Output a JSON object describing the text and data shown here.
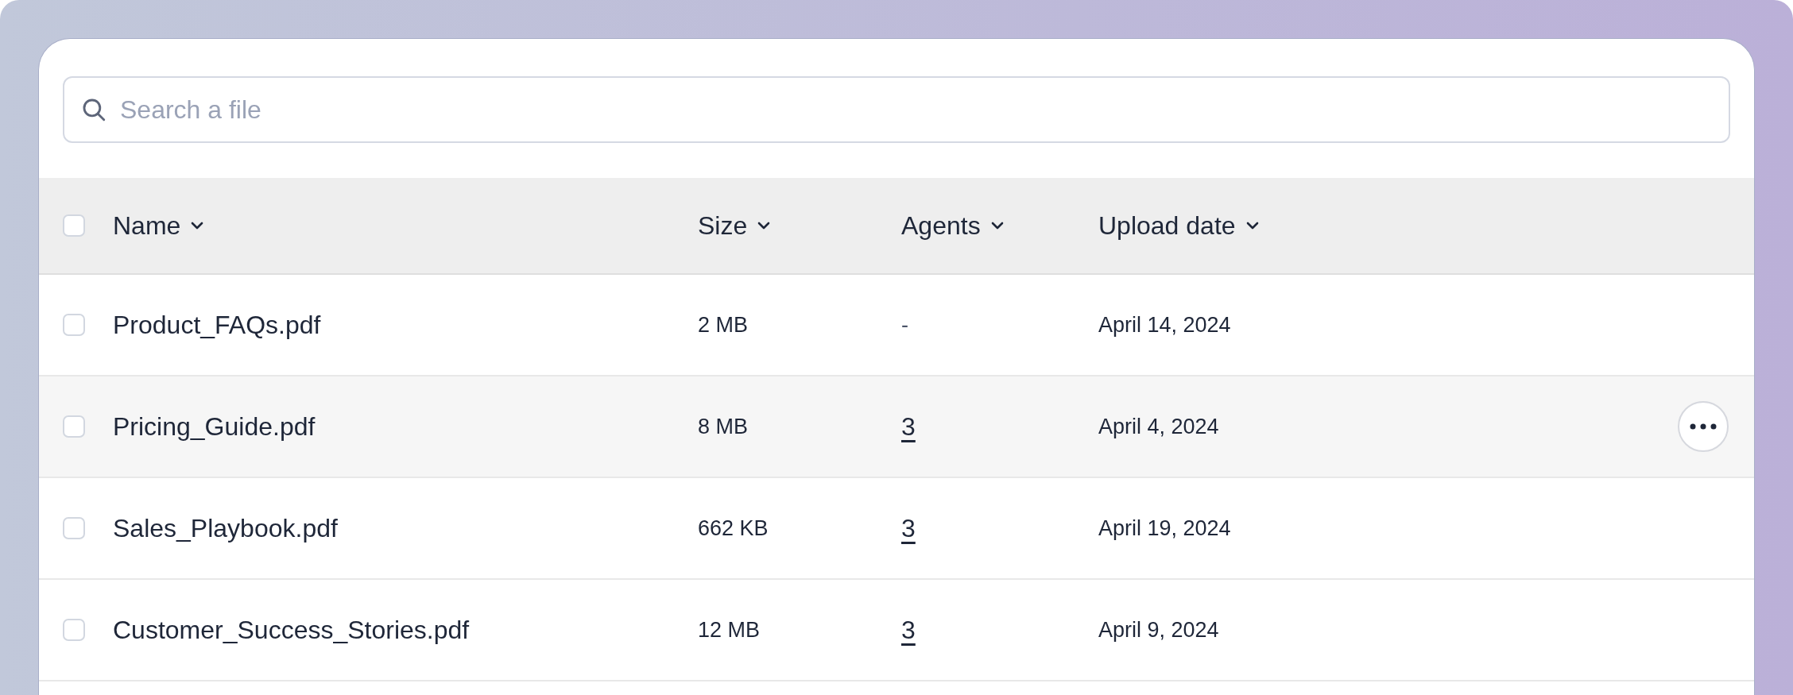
{
  "search": {
    "placeholder": "Search a file"
  },
  "table": {
    "select_all": {
      "checked": false
    },
    "columns": [
      {
        "label": "Name"
      },
      {
        "label": "Size"
      },
      {
        "label": "Agents"
      },
      {
        "label": "Upload date"
      }
    ],
    "rows": [
      {
        "name": "Product_FAQs.pdf",
        "size": "2 MB",
        "agents": {
          "text": "-",
          "kind": "plain"
        },
        "date": "April 14, 2024",
        "checked": false,
        "hovered": false
      },
      {
        "name": "Pricing_Guide.pdf",
        "size": "8 MB",
        "agents": {
          "text": "3",
          "kind": "link"
        },
        "date": "April 4, 2024",
        "checked": false,
        "hovered": true
      },
      {
        "name": "Sales_Playbook.pdf",
        "size": "662 KB",
        "agents": {
          "text": "3",
          "kind": "link"
        },
        "date": "April 19, 2024",
        "checked": false,
        "hovered": false
      },
      {
        "name": "Customer_Success_Stories.pdf",
        "size": "12 MB",
        "agents": {
          "text": "3",
          "kind": "link"
        },
        "date": "April 9, 2024",
        "checked": false,
        "hovered": false
      }
    ]
  }
}
